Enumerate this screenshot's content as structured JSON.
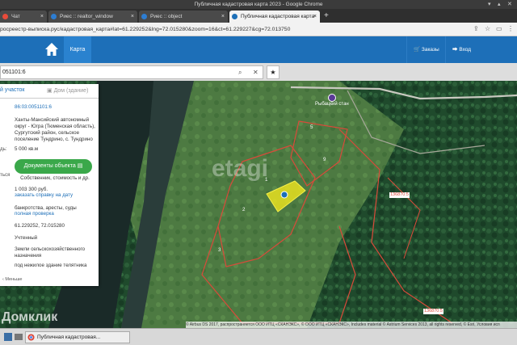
{
  "window": {
    "title": "Публичная кадастровая карта 2023 - Google Chrome"
  },
  "tabs": [
    {
      "label": "Чат",
      "color": "#e84b3a",
      "active": false
    },
    {
      "label": "Риес :: realtor_window",
      "color": "#2d7dd2",
      "active": false
    },
    {
      "label": "Риес :: object",
      "color": "#2d7dd2",
      "active": false
    },
    {
      "label": "Публичная кадастровая карта",
      "color": "#1d6fb8",
      "active": true
    }
  ],
  "address": {
    "url": "росреестр-выписка.рус/кадастровая_карта#lat=61.229252&lng=72.015280&zoom=16&ct=61.229227&cg=72.013750"
  },
  "header": {
    "nav_map": "Карта",
    "orders": "Заказы",
    "login": "Вход"
  },
  "search": {
    "value": "051101:6"
  },
  "panel": {
    "tab_parcel": "й участок",
    "tab_building": "Дом (здание)",
    "cadastral_number": "86:03:0051101:6",
    "address_label": "",
    "address": "Ханты-Мансийский автономный округ - Югра (Тюменская область), Сургутский район, сельское поселение Тундрино, с. Тундрино",
    "area_label": "дь:",
    "area": "5 000 кв.м",
    "owner_label": "ться",
    "doc_button": "Документы объекта",
    "doc_sub": "Собственник, стоимость и др.",
    "cost": "1 003 300 руб.",
    "cost_link": "заказать справку на дату",
    "bankruptcy": "банкротства, аресты, суды",
    "full_check": "полная проверка",
    "coords": "61.229252, 72.015280",
    "status": "Учтенный",
    "category": "Земли сельскохозяйственного назначения",
    "use": "под нежилое здание телятника",
    "collapse": "Меньше"
  },
  "map": {
    "fishing_camp": "Рыбацкий стан",
    "labels": [
      "1",
      "2",
      "3",
      "5",
      "9"
    ],
    "parcel_a": "136870:5",
    "parcel_b": "136870:5",
    "copyright": "© Airbus DS 2017, распространяется ООО ИТЦ «СКАНЭКС», © ООО ИТЦ «СКАНЭКС», Includes material © Astrium Services 2013, all rights reserved, © Esri, Условия исп",
    "watermark": "Домклик",
    "etagi": "etagi"
  },
  "taskbar": {
    "app": "Публичная кадастровая..."
  }
}
